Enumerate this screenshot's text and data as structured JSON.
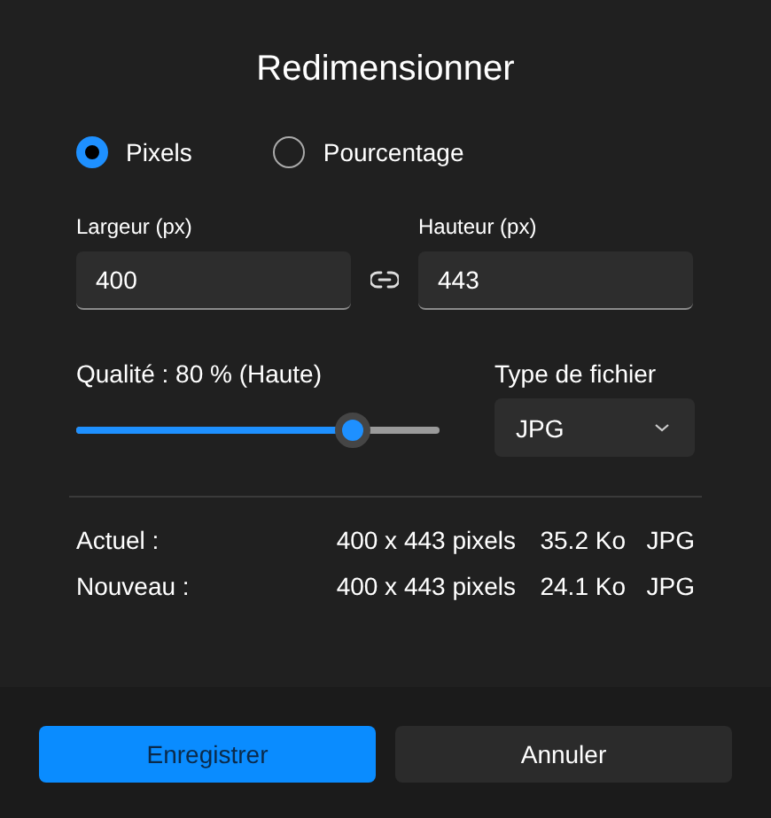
{
  "dialog": {
    "title": "Redimensionner"
  },
  "mode_options": [
    {
      "label": "Pixels",
      "selected": true
    },
    {
      "label": "Pourcentage",
      "selected": false
    }
  ],
  "width_field": {
    "label": "Largeur (px)",
    "value": "400"
  },
  "height_field": {
    "label": "Hauteur (px)",
    "value": "443"
  },
  "quality": {
    "label": "Qualité : 80 % (Haute)",
    "level": 0.76
  },
  "file_type": {
    "label": "Type de fichier",
    "value": "JPG"
  },
  "info_rows": [
    {
      "label": "Actuel :",
      "dimensions": "400 x 443 pixels",
      "size": "35.2 Ko",
      "format": "JPG"
    },
    {
      "label": "Nouveau :",
      "dimensions": "400 x 443 pixels",
      "size": "24.1 Ko",
      "format": "JPG"
    }
  ],
  "buttons": [
    {
      "label": "Enregistrer",
      "kind": "primary"
    },
    {
      "label": "Annuler",
      "kind": "secondary"
    }
  ]
}
